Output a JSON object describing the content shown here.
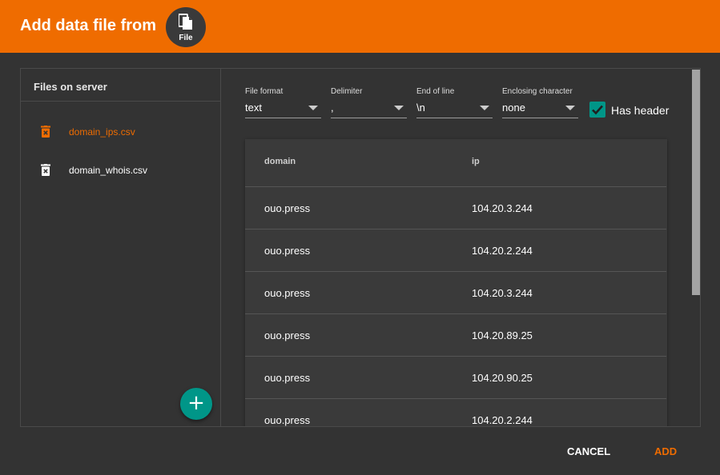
{
  "dialog": {
    "title": "Add data file from",
    "source": {
      "label": "File",
      "icon": "file-copy-icon"
    }
  },
  "files_panel": {
    "title": "Files on server",
    "files": [
      {
        "name": "domain_ips.csv",
        "selected": true,
        "icon": "delete-file-icon"
      },
      {
        "name": "domain_whois.csv",
        "selected": false,
        "icon": "delete-file-icon"
      }
    ],
    "add_button": {
      "label": "+",
      "icon": "plus-icon"
    }
  },
  "options": {
    "file_format": {
      "label": "File format",
      "value": "text"
    },
    "delimiter": {
      "label": "Delimiter",
      "value": ","
    },
    "end_of_line": {
      "label": "End of line",
      "value": "\\n"
    },
    "enclosing_character": {
      "label": "Enclosing character",
      "value": "none"
    },
    "has_header": {
      "label": "Has header",
      "checked": true
    }
  },
  "preview": {
    "columns": [
      "domain",
      "ip"
    ],
    "rows": [
      [
        "ouo.press",
        "104.20.3.244"
      ],
      [
        "ouo.press",
        "104.20.2.244"
      ],
      [
        "ouo.press",
        "104.20.3.244"
      ],
      [
        "ouo.press",
        "104.20.89.25"
      ],
      [
        "ouo.press",
        "104.20.90.25"
      ],
      [
        "ouo.press",
        "104.20.2.244"
      ]
    ]
  },
  "actions": {
    "cancel": "CANCEL",
    "add": "ADD"
  },
  "colors": {
    "accent": "#ef6c00",
    "teal": "#009688",
    "background": "#333333"
  }
}
